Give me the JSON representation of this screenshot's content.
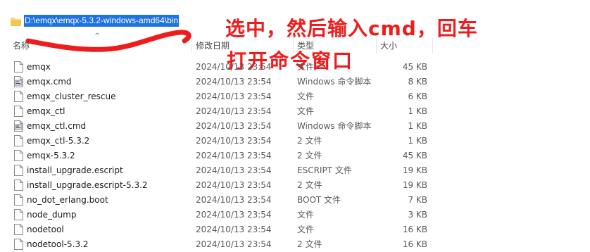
{
  "address": {
    "path": "D:\\emqx\\emqx-5.3.2-windows-amd64\\bin"
  },
  "annotation": {
    "line1": "选中，然后输入cmd，回车",
    "line2": "打开命令窗口",
    "color": "#ee1c1c"
  },
  "columns": {
    "name": "名称",
    "date": "修改日期",
    "type": "类型",
    "size": "大小"
  },
  "files": [
    {
      "name": "emqx",
      "date": "2024/10/13 23:54",
      "type": "文件",
      "size": "45 KB",
      "icon": "file-icon"
    },
    {
      "name": "emqx.cmd",
      "date": "2024/10/13 23:54",
      "type": "Windows 命令脚本",
      "size": "8 KB",
      "icon": "script-file-icon"
    },
    {
      "name": "emqx_cluster_rescue",
      "date": "2024/10/13 23:54",
      "type": "文件",
      "size": "6 KB",
      "icon": "file-icon"
    },
    {
      "name": "emqx_ctl",
      "date": "2024/10/13 23:54",
      "type": "文件",
      "size": "1 KB",
      "icon": "file-icon"
    },
    {
      "name": "emqx_ctl.cmd",
      "date": "2024/10/13 23:54",
      "type": "Windows 命令脚本",
      "size": "1 KB",
      "icon": "script-file-icon"
    },
    {
      "name": "emqx_ctl-5.3.2",
      "date": "2024/10/13 23:54",
      "type": "2 文件",
      "size": "1 KB",
      "icon": "file-icon"
    },
    {
      "name": "emqx-5.3.2",
      "date": "2024/10/13 23:54",
      "type": "2 文件",
      "size": "45 KB",
      "icon": "file-icon"
    },
    {
      "name": "install_upgrade.escript",
      "date": "2024/10/13 23:54",
      "type": "ESCRIPT 文件",
      "size": "19 KB",
      "icon": "file-icon"
    },
    {
      "name": "install_upgrade.escript-5.3.2",
      "date": "2024/10/13 23:54",
      "type": "2 文件",
      "size": "19 KB",
      "icon": "file-icon"
    },
    {
      "name": "no_dot_erlang.boot",
      "date": "2024/10/13 23:54",
      "type": "BOOT 文件",
      "size": "7 KB",
      "icon": "file-icon"
    },
    {
      "name": "node_dump",
      "date": "2024/10/13 23:54",
      "type": "文件",
      "size": "3 KB",
      "icon": "file-icon"
    },
    {
      "name": "nodetool",
      "date": "2024/10/13 23:54",
      "type": "文件",
      "size": "16 KB",
      "icon": "file-icon"
    },
    {
      "name": "nodetool-5.3.2",
      "date": "2024/10/13 23:54",
      "type": "2 文件",
      "size": "16 KB",
      "icon": "file-icon"
    }
  ]
}
